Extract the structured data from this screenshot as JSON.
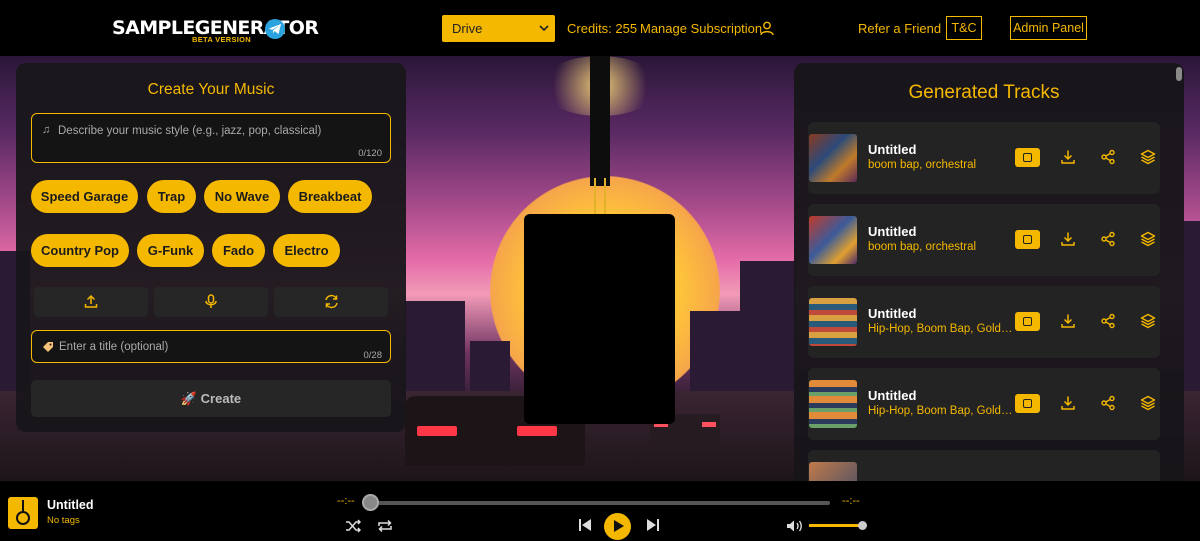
{
  "header": {
    "logo_text": "SAMPLEGENERATOR",
    "logo_badge": "BETA VERSION",
    "drive_select": "Drive",
    "credits": "Credits: 255",
    "manage_subscription": "Manage Subscription",
    "refer": "Refer a Friend",
    "tc": "T&C",
    "admin": "Admin Panel",
    "accent_color": "#f5b800"
  },
  "create": {
    "title": "Create Your Music",
    "description_placeholder": "Describe your music style (e.g., jazz, pop, classical)",
    "description_count": "0/120",
    "genres": [
      "Speed Garage",
      "Trap",
      "No Wave",
      "Breakbeat",
      "Country Pop",
      "G-Funk",
      "Fado",
      "Electro"
    ],
    "tools": [
      "upload-icon",
      "microphone-icon",
      "refresh-icon"
    ],
    "title_placeholder": "Enter a title (optional)",
    "title_count": "0/28",
    "create_label": "Create"
  },
  "tracks": {
    "title": "Generated Tracks",
    "items": [
      {
        "name": "Untitled",
        "tags": "boom bap, orchestral"
      },
      {
        "name": "Untitled",
        "tags": "boom bap, orchestral"
      },
      {
        "name": "Untitled",
        "tags": "Hip-Hop, Boom Bap, Golden Era"
      },
      {
        "name": "Untitled",
        "tags": "Hip-Hop, Boom Bap, Golden Era"
      }
    ]
  },
  "player": {
    "title": "Untitled",
    "tags": "No tags",
    "time_current": "--:--",
    "time_total": "--:--"
  }
}
